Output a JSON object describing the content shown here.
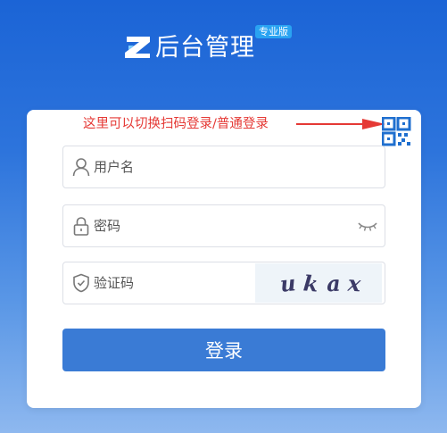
{
  "brand": {
    "logo_icon": "z-logo-icon",
    "title": "后台管理",
    "badge": "专业版"
  },
  "hint": {
    "text": "这里可以切换扫码登录/普通登录",
    "color": "#e53935"
  },
  "qr_toggle": {
    "icon": "qr-code-icon"
  },
  "fields": {
    "username": {
      "placeholder": "用户名",
      "value": "",
      "icon": "user-icon"
    },
    "password": {
      "placeholder": "密码",
      "value": "",
      "icon": "lock-icon",
      "toggle_icon": "eye-closed-icon"
    },
    "captcha": {
      "placeholder": "验证码",
      "value": "",
      "icon": "shield-icon",
      "image_chars": [
        "u",
        "k",
        "a",
        "x"
      ]
    }
  },
  "login_button": {
    "label": "登录"
  },
  "colors": {
    "background_top": "#1b64d6",
    "background_bottom": "#8eb8ef",
    "accent": "#3a7bd5",
    "badge": "#2aa3f2"
  }
}
